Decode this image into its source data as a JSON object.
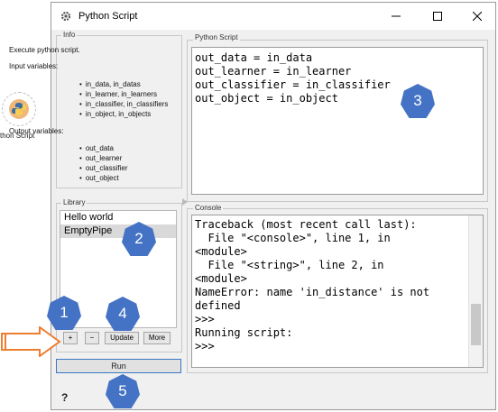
{
  "canvas": {
    "node_label": "ython Script"
  },
  "window": {
    "title": "Python Script",
    "controls": {
      "minimize": "minimize",
      "maximize": "maximize",
      "close": "close"
    }
  },
  "info": {
    "group": "Info",
    "description": "Execute python script.",
    "input_heading": "Input variables:",
    "inputs": [
      "in_data, in_datas",
      "in_learner, in_learners",
      "in_classifier, in_classifiers",
      "in_object, in_objects"
    ],
    "output_heading": "Output variables:",
    "outputs": [
      "out_data",
      "out_learner",
      "out_classifier",
      "out_object"
    ]
  },
  "library": {
    "group": "Library",
    "items": [
      "Hello world",
      "EmptyPipe"
    ],
    "selected_index": 1,
    "add_label": "+",
    "remove_label": "−",
    "update_label": "Update",
    "more_label": "More"
  },
  "run_label": "Run",
  "help_label": "?",
  "editor": {
    "group": "Python Script",
    "lines": [
      "out_data = in_data",
      "out_learner = in_learner",
      "out_classifier = in_classifier",
      "out_object = in_object"
    ]
  },
  "console": {
    "group": "Console",
    "lines": [
      "Traceback (most recent call last):",
      "  File \"<console>\", line 1, in",
      "<module>",
      "  File \"<string>\", line 2, in",
      "<module>",
      "NameError: name 'in_distance' is not",
      "defined",
      ">>>",
      "Running script:",
      ">>>"
    ]
  },
  "callouts": [
    "1",
    "2",
    "3",
    "4",
    "5"
  ],
  "colors": {
    "callout": "#4472c4",
    "arrow": "#ed7d31",
    "run_border": "#3b78c4"
  }
}
